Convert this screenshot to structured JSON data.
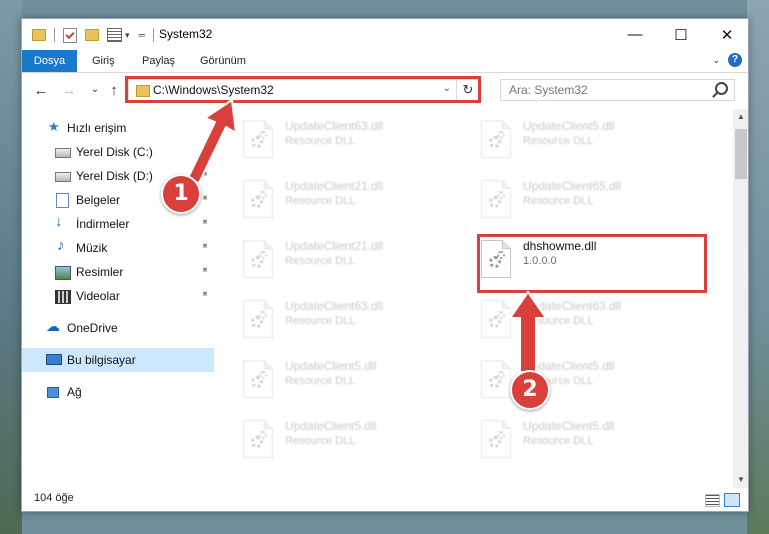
{
  "window": {
    "title": "System32",
    "minimize_glyph": "—",
    "maximize_glyph": "☐",
    "close_glyph": "✕"
  },
  "ribbon": {
    "tabs": [
      "Dosya",
      "Giriş",
      "Paylaş",
      "Görünüm"
    ],
    "help_glyph": "?"
  },
  "nav": {
    "back_glyph": "←",
    "forward_glyph": "→",
    "recent_glyph": "⌄",
    "up_glyph": "↑",
    "address": "C:\\Windows\\System32",
    "refresh_glyph": "↻",
    "search_placeholder": "Ara: System32"
  },
  "sidebar": {
    "items": [
      {
        "label": "Hızlı erişim",
        "icon": "star-icon"
      },
      {
        "label": "Yerel Disk (C:)",
        "icon": "drive-icon"
      },
      {
        "label": "Yerel Disk (D:)",
        "icon": "drive-icon"
      },
      {
        "label": "Belgeler",
        "icon": "document-icon"
      },
      {
        "label": "İndirmeler",
        "icon": "download-icon"
      },
      {
        "label": "Müzik",
        "icon": "music-icon"
      },
      {
        "label": "Resimler",
        "icon": "pictures-icon"
      },
      {
        "label": "Videolar",
        "icon": "videos-icon"
      },
      {
        "label": "OneDrive",
        "icon": "cloud-icon"
      },
      {
        "label": "Bu bilgisayar",
        "icon": "computer-icon"
      },
      {
        "label": "Ağ",
        "icon": "network-icon"
      }
    ],
    "pin_glyph": "📌"
  },
  "files": [
    {
      "name": "UpdateClient63.dll",
      "sub": "Resource DLL"
    },
    {
      "name": "UpdateClient5.dll",
      "sub": "Resource DLL"
    },
    {
      "name": "UpdateClient21.dll",
      "sub": "Resource DLL"
    },
    {
      "name": "UpdateClient65.dll",
      "sub": "Resource DLL"
    },
    {
      "name": "UpdateClient21.dll",
      "sub": "Resource DLL"
    },
    {
      "name": "dhshowme.dll",
      "sub": "1.0.0.0"
    },
    {
      "name": "UpdateClient63.dll",
      "sub": "Resource DLL"
    },
    {
      "name": "UpdateClient63.dll",
      "sub": "Resource DLL"
    },
    {
      "name": "UpdateClient5.dll",
      "sub": "Resource DLL"
    },
    {
      "name": "UpdateClient5.dll",
      "sub": "Resource DLL"
    },
    {
      "name": "UpdateClient5.dll",
      "sub": "Resource DLL"
    },
    {
      "name": "UpdateClient5.dll",
      "sub": "Resource DLL"
    }
  ],
  "status": {
    "item_count": "104 öğe"
  },
  "annotations": {
    "step1": "1",
    "step2": "2",
    "color": "#d9403c"
  }
}
